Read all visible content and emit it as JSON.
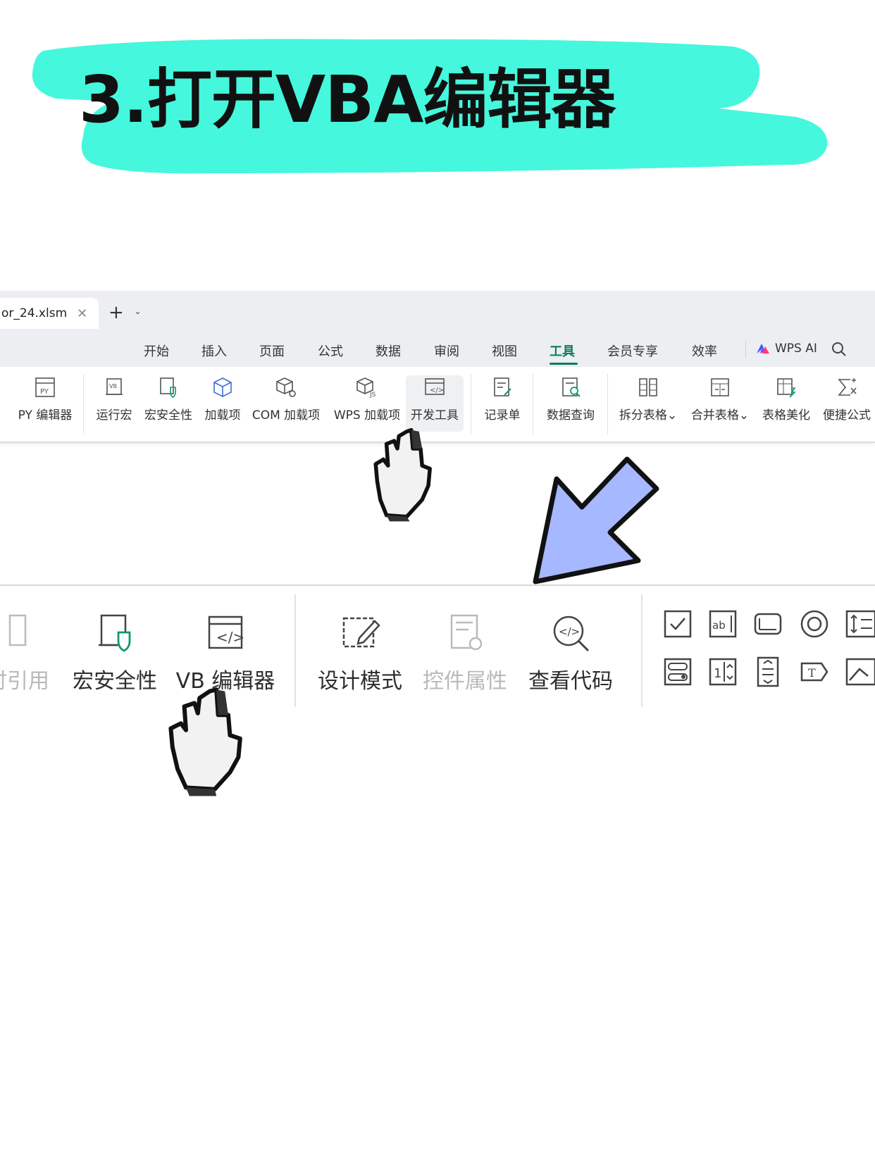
{
  "banner": {
    "title": "3.打开VBA编辑器",
    "highlight_color": "#45f7dc"
  },
  "window": {
    "file_tab": {
      "name": "or_24.xlsm",
      "close_icon": "close-icon"
    },
    "tab_add_icon": "plus-icon",
    "tab_more_icon": "chevron-down-icon"
  },
  "menu": {
    "items": [
      "开始",
      "插入",
      "页面",
      "公式",
      "数据",
      "审阅",
      "视图",
      "工具",
      "会员专享",
      "效率"
    ],
    "active": "工具",
    "ai_label": "WPS AI",
    "accent": "#0f7c5e"
  },
  "toolbar": {
    "items": [
      {
        "label": "PY 编辑器",
        "icon": "py-editor-icon"
      },
      {
        "label": "运行宏",
        "icon": "run-macro-icon"
      },
      {
        "label": "宏安全性",
        "icon": "macro-security-icon"
      },
      {
        "label": "加载项",
        "icon": "addin-cube-icon"
      },
      {
        "label": "COM 加载项",
        "icon": "com-addin-icon"
      },
      {
        "label": "WPS 加载项",
        "icon": "js-addin-icon"
      },
      {
        "label": "开发工具",
        "icon": "developer-tools-icon"
      },
      {
        "label": "记录单",
        "icon": "record-form-icon"
      },
      {
        "label": "数据查询",
        "icon": "data-query-icon"
      },
      {
        "label": "拆分表格",
        "icon": "split-table-icon"
      },
      {
        "label": "合并表格",
        "icon": "merge-table-icon"
      },
      {
        "label": "表格美化",
        "icon": "beautify-table-icon"
      },
      {
        "label": "便捷公式",
        "icon": "quick-formula-icon"
      }
    ]
  },
  "zoom_toolbar": {
    "items": [
      {
        "label": "时引用",
        "icon": "relative-reference-icon",
        "dimmed": true
      },
      {
        "label": "宏安全性",
        "icon": "macro-security-icon",
        "dimmed": false
      },
      {
        "label": "VB 编辑器",
        "icon": "vb-editor-icon",
        "dimmed": false
      },
      {
        "label": "设计模式",
        "icon": "design-mode-icon",
        "dimmed": false
      },
      {
        "label": "控件属性",
        "icon": "control-properties-icon",
        "dimmed": true
      },
      {
        "label": "查看代码",
        "icon": "view-code-icon",
        "dimmed": false
      }
    ],
    "controls": [
      "checkbox-icon",
      "textbox-icon",
      "button-icon",
      "radio-icon",
      "spin-icon",
      "combo-icon",
      "number-spin-icon",
      "list-icon",
      "label-icon",
      "image-icon"
    ]
  },
  "annotations": {
    "arrow_color": "#a6b8ff",
    "pointer_icon": "hand-pointer-icon"
  }
}
